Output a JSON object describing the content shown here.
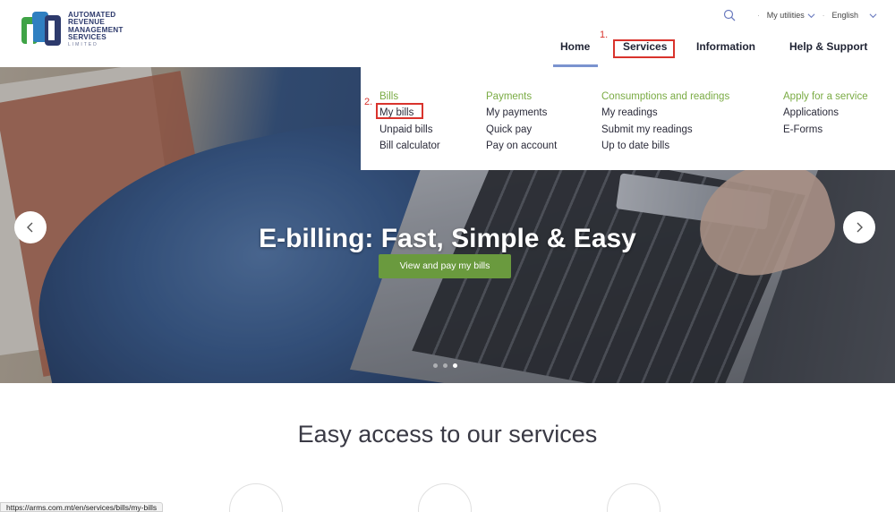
{
  "logo": {
    "lines": [
      "AUTOMATED",
      "REVENUE",
      "MANAGEMENT",
      "SERVICES"
    ],
    "sub": "LIMITED",
    "colors": [
      "#2f6db0",
      "#3fa346",
      "#2d3a6c"
    ]
  },
  "utility": {
    "search_icon": "search-icon",
    "my_utilities": "My utilities",
    "language": "English"
  },
  "nav": {
    "home": "Home",
    "services": "Services",
    "information": "Information",
    "help": "Help & Support"
  },
  "annotations": {
    "step1": "1.",
    "step2": "2.",
    "highlight_color": "#d9332c"
  },
  "menu": {
    "columns": [
      {
        "heading": "Bills",
        "items": [
          "My bills",
          "Unpaid bills",
          "Bill calculator"
        ]
      },
      {
        "heading": "Payments",
        "items": [
          "My payments",
          "Quick pay",
          "Pay on account"
        ]
      },
      {
        "heading": "Consumptions and readings",
        "items": [
          "My readings",
          "Submit my readings",
          "Up to date bills"
        ]
      },
      {
        "heading": "Apply for a service",
        "items": [
          "Applications",
          "E-Forms"
        ]
      }
    ],
    "heading_color": "#7aab44"
  },
  "hero": {
    "title": "E-billing: Fast, Simple & Easy",
    "button": "View and pay my bills",
    "button_color": "#6a9a3e",
    "slides": 3,
    "active_slide": 3
  },
  "section": {
    "title": "Easy access to our services"
  },
  "status_url": "https://arms.com.mt/en/services/bills/my-bills"
}
